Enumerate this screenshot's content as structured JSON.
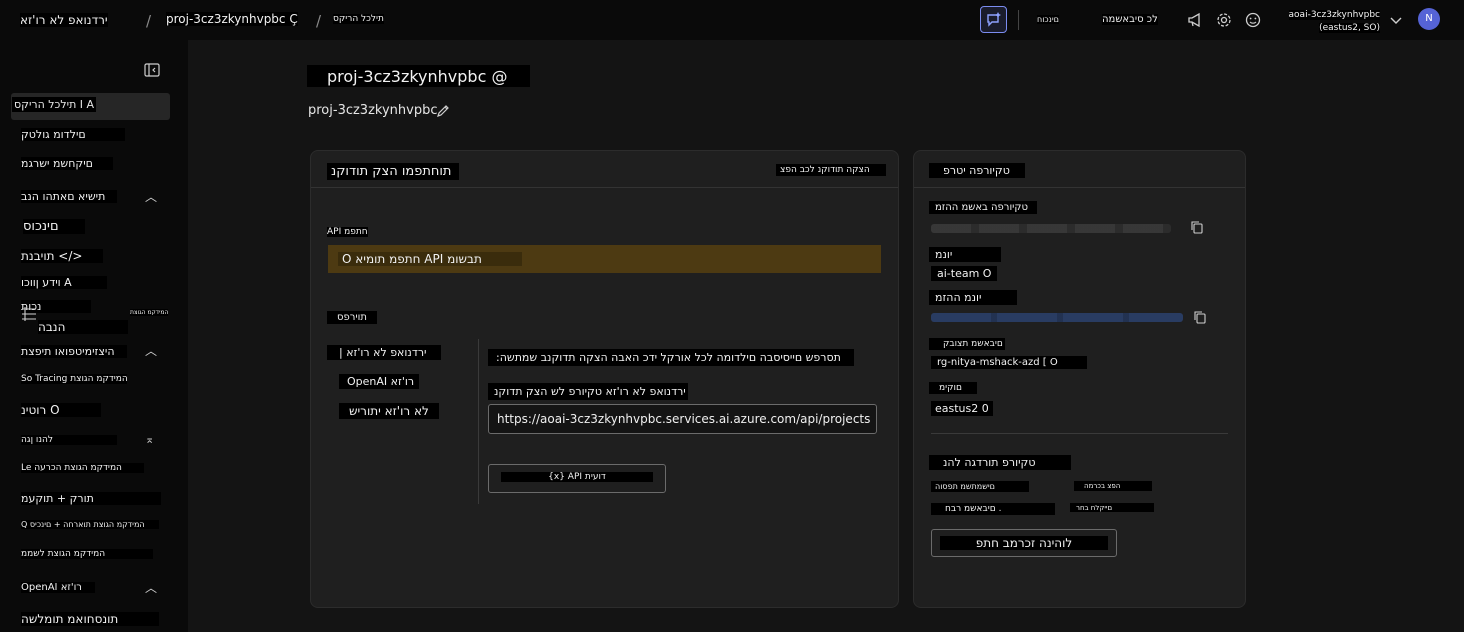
{
  "topbar": {
    "brand": "ירדנואפ לא רו'זא",
    "project_crumb": "proj-3cz3zkynhvpbc",
    "crumb_suffix": "Ç",
    "page_crumb": "תילכל הריקס",
    "preview_label": "םינכוח",
    "all_resources": "לכ סיבאשמה",
    "account_name": "aoai-3cz3zkynhvpbc",
    "account_region": "(eastus2, SO)",
    "avatar_letter": "N"
  },
  "sidebar": {
    "items": [
      {
        "label": "תילכל הריקס I A",
        "selected": true
      },
      {
        "label": "םילדומ גולטק"
      },
      {
        "label": "םיקחשמ ישרגמ"
      },
      {
        "label": "תישיא םאתהו הנב"
      },
      {
        "label": "םינכוס"
      },
      {
        "label": "תויבנת </>"
      },
      {
        "label": "וידע ןווכו A"
      },
      {
        "label": "נכות"
      },
      {
        "label": "הנבה"
      },
      {
        "label": "היצזימיטפואו תיפצת"
      },
      {
        "label": "So Tracing המידקמ הגוצת"
      },
      {
        "label": "רוטינ O"
      },
      {
        "label": "להנו ןגה"
      },
      {
        "label": "Le המידקמ הגוצת הכרעה"
      },
      {
        "label": "תורק + תוקעמ"
      },
      {
        "label": "Q המידקמ הגוצת תוארחה + םינכיס"
      },
      {
        "label": "המידקמ הגוצת לשממ"
      },
      {
        "label": "OpenAI רו'זא"
      },
      {
        "label": "תונסחואמ תומלשה"
      }
    ],
    "small_tag": "המידקמ הגוצת"
  },
  "main": {
    "title": "proj-3cz3zkynhvpbc @",
    "name": "proj-3cz3zkynhvpbc",
    "endpoints_card": {
      "title": "תוחתפמו הצק תודוקנ",
      "view_all": "הצקה תודוקנ לכב הפצ",
      "api_key_label": "API חתפמ",
      "api_key_banner": "O חתפמ תומיא API תבשומ",
      "libraries_label": "תוירפס",
      "tabs": [
        "| ירדנואפ לא רו'זא",
        "OpenAI רו'זא",
        "לא רו'זא יתוריש"
      ],
      "instruction": ":תסרפש םייסיסבה םילדומה לכל אורקל ידכ האבה הצקה תדוקנב שמתשה",
      "endpoint_label": "ירדנואפ לא רו'זא טקיורפ לש הצק תדוקנ",
      "endpoint_url": "https://aoai-3cz3zkynhvpbc.services.ai.azure.com/api/projects",
      "api_docs_button": "{x} API דועית"
    },
    "details_card": {
      "title": "טקיורפה יטרפ",
      "id_label": "טקיורפה באשמ ההזמ",
      "owner_label": "יונמ",
      "owner_value": "ai-team O",
      "sub_id_label": "יונמ ההזמ",
      "rg_label": "םיבאשמ תצובק",
      "rg_value": "rg-nitya-mshack-azd [ O",
      "location_label": "םוקימ",
      "location_value": "eastus2 0",
      "config_title": "טקיורפ תורדגה להנ",
      "chips": [
        "םישמתשמ תפסוה",
        "הפצ בכרמה",
        "םיבאשמ רבח .",
        "םייקלח בחר"
      ],
      "manage_button": "לוהינה זכרמב חתפ"
    }
  },
  "colors": {
    "background": "#0a0a0a",
    "main": "#141414",
    "card": "#1f1f1f",
    "banner": "#4d3a12",
    "accent": "#7b8cf0",
    "avatar": "#5563d6"
  },
  "icons": [
    "sparkle-chat-icon",
    "megaphone-icon",
    "gear-icon",
    "smiley-icon",
    "chevron-down-icon",
    "collapse-sidebar-icon",
    "copy-icon",
    "pencil-icon",
    "chevron-up-icon"
  ]
}
